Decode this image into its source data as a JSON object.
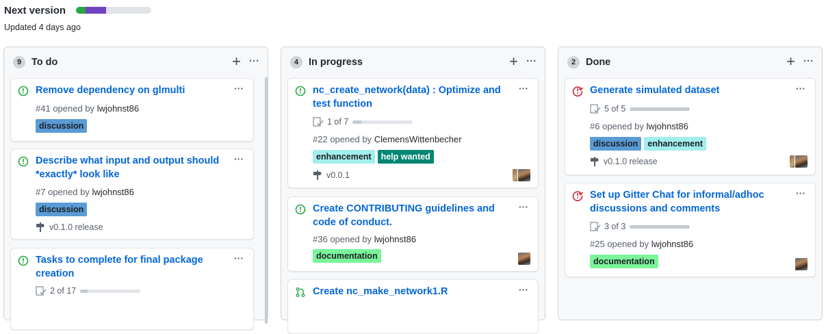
{
  "project": {
    "title": "Next version",
    "updated": "Updated 4 days ago",
    "progress": [
      {
        "fraction": 0.13,
        "color": "#28a745"
      },
      {
        "fraction": 0.27,
        "color": "#6f42c1"
      },
      {
        "fraction": 0.6,
        "color": "#e1e4e8"
      }
    ]
  },
  "colors": {
    "open": "#28a745",
    "closed": "#cb2431",
    "link": "#0366d6",
    "discussion": "#5a9bd5",
    "enhancement": "#a2eeef",
    "help_wanted": "#008672",
    "documentation": "#7af59b"
  },
  "columns": [
    {
      "count": "9",
      "title": "To do",
      "cards": [
        {
          "title": "Remove dependency on glmulti",
          "number": "#41",
          "opened_by": "opened by",
          "user": "lwjohnst86",
          "labels": [
            "discussion"
          ],
          "icon": "issue-open-icon"
        },
        {
          "title": "Describe what input and output should *exactly* look like",
          "number": "#7",
          "opened_by": "opened by",
          "user": "lwjohnst86",
          "labels": [
            "discussion"
          ],
          "milestone": "v0.1.0 release",
          "icon": "issue-open-icon"
        },
        {
          "title": "Tasks to complete for final package creation",
          "tasks": "2 of 17",
          "task_progress": 0.12,
          "icon": "issue-open-icon"
        }
      ]
    },
    {
      "count": "4",
      "title": "In progress",
      "cards": [
        {
          "title": "nc_create_network(data) : Optimize and test function",
          "tasks": "1 of 7",
          "task_progress": 0.14,
          "number": "#22",
          "opened_by": "opened by",
          "user": "ClemensWittenbecher",
          "labels": [
            "enhancement",
            "help wanted"
          ],
          "milestone": "v0.0.1",
          "icon": "issue-open-icon"
        },
        {
          "title": "Create CONTRIBUTING guidelines and code of conduct.",
          "number": "#36",
          "opened_by": "opened by",
          "user": "lwjohnst86",
          "labels": [
            "documentation"
          ],
          "icon": "issue-open-icon"
        },
        {
          "title": "Create nc_make_network1.R",
          "icon": "pull-request-icon"
        }
      ]
    },
    {
      "count": "2",
      "title": "Done",
      "cards": [
        {
          "title": "Generate simulated dataset",
          "tasks": "5 of 5",
          "task_progress": 1.0,
          "number": "#6",
          "opened_by": "opened by",
          "user": "lwjohnst86",
          "labels": [
            "discussion",
            "enhancement"
          ],
          "milestone": "v0.1.0 release",
          "icon": "issue-closed-icon"
        },
        {
          "title": "Set up Gitter Chat for informal/adhoc discussions and comments",
          "tasks": "3 of 3",
          "task_progress": 1.0,
          "number": "#25",
          "opened_by": "opened by",
          "user": "lwjohnst86",
          "labels": [
            "documentation"
          ],
          "icon": "issue-closed-icon"
        }
      ]
    }
  ],
  "icons": {
    "add": "+",
    "more": "···"
  }
}
